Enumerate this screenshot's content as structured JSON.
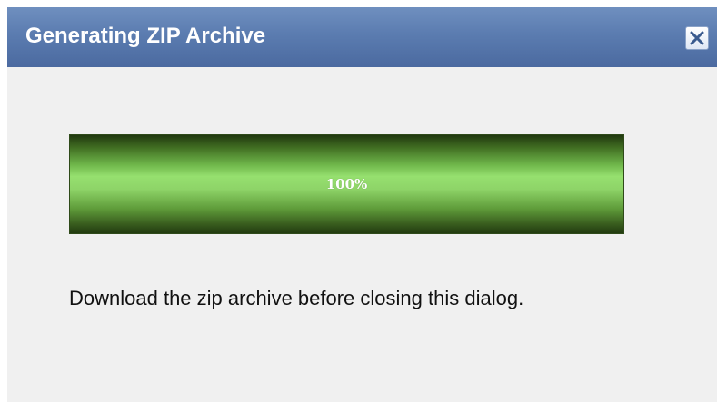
{
  "dialog": {
    "title": "Generating ZIP Archive",
    "close_icon": "close-icon",
    "progress": {
      "value": 100,
      "label": "100%"
    },
    "message": "Download the zip archive before closing this dialog."
  },
  "colors": {
    "titlebar": "#5b7cb0",
    "progress_fill": "#96e06f",
    "dialog_background": "#f0f0f0"
  }
}
